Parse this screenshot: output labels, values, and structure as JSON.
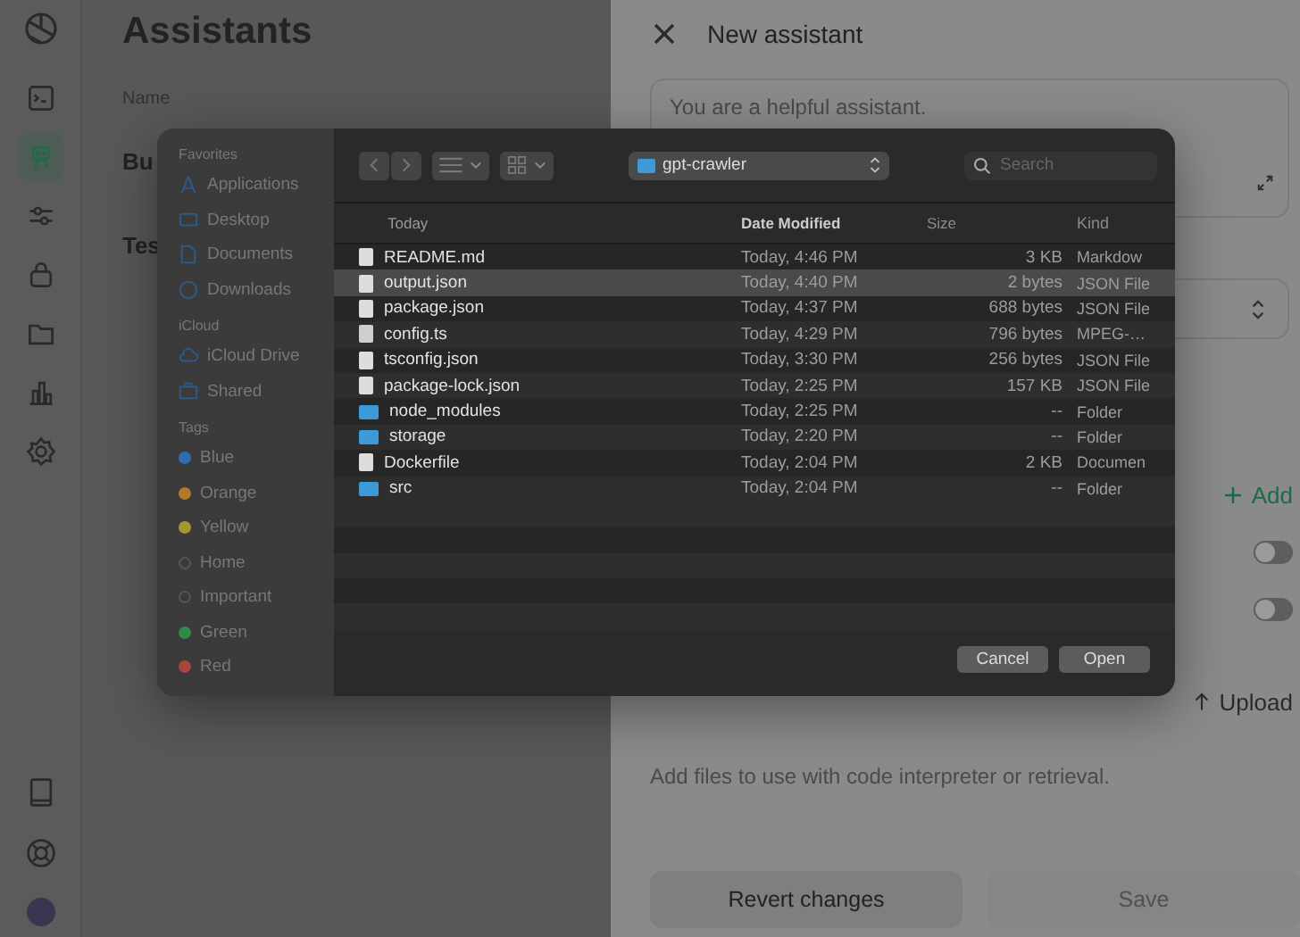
{
  "nav": {
    "top": [
      {
        "selected": false
      },
      {
        "selected": true
      },
      {
        "selected": false
      },
      {
        "selected": false
      },
      {
        "selected": false
      },
      {
        "selected": false
      },
      {
        "selected": false
      }
    ]
  },
  "list": {
    "title": "Assistants",
    "header": "Name",
    "items": [
      "Bu",
      "Tes"
    ]
  },
  "panel": {
    "title": "New assistant",
    "instructions_placeholder": "You are a helpful assistant.",
    "tools": [
      {
        "kind": "add",
        "label": "Add"
      },
      {
        "kind": "toggle",
        "on": false
      },
      {
        "kind": "toggle",
        "on": false
      },
      {
        "kind": "upload",
        "label": "Upload"
      }
    ],
    "files_hint": "Add files to use with code interpreter or retrieval.",
    "buttons": [
      {
        "label": "Revert changes",
        "disabled": false
      },
      {
        "label": "Save",
        "disabled": true
      }
    ]
  },
  "dialog": {
    "sidebar": [
      {
        "heading": "Favorites",
        "items": [
          {
            "label": "Applications"
          },
          {
            "label": "Desktop"
          },
          {
            "label": "Documents"
          },
          {
            "label": "Downloads"
          }
        ]
      },
      {
        "heading": "iCloud",
        "items": [
          {
            "label": "iCloud Drive"
          },
          {
            "label": "Shared"
          }
        ]
      },
      {
        "heading": "Tags",
        "items": [
          {
            "label": "Blue",
            "color": "#2f6db0"
          },
          {
            "label": "Orange",
            "color": "#b07a2a"
          },
          {
            "label": "Yellow",
            "color": "#a8962a"
          },
          {
            "label": "Home"
          },
          {
            "label": "Important"
          },
          {
            "label": "Green",
            "color": "#2f8a45"
          },
          {
            "label": "Red",
            "color": "#a8463c"
          }
        ]
      }
    ],
    "location": "gpt-crawler",
    "search_placeholder": "Search",
    "columns": [
      "Today",
      "Date Modified",
      "Size",
      "Kind"
    ],
    "files": [
      {
        "name": "README.md",
        "kind": "doc",
        "date": "Today, 4:46 PM",
        "size": "3 KB",
        "type": "Markdow",
        "selected": false
      },
      {
        "name": "output.json",
        "kind": "doc",
        "date": "Today, 4:40 PM",
        "size": "2 bytes",
        "type": "JSON File",
        "selected": true
      },
      {
        "name": "package.json",
        "kind": "doc",
        "date": "Today, 4:37 PM",
        "size": "688 bytes",
        "type": "JSON File",
        "selected": false
      },
      {
        "name": "config.ts",
        "kind": "ts",
        "date": "Today, 4:29 PM",
        "size": "796 bytes",
        "type": "MPEG-…",
        "selected": false
      },
      {
        "name": "tsconfig.json",
        "kind": "doc",
        "date": "Today, 3:30 PM",
        "size": "256 bytes",
        "type": "JSON File",
        "selected": false
      },
      {
        "name": "package-lock.json",
        "kind": "doc",
        "date": "Today, 2:25 PM",
        "size": "157 KB",
        "type": "JSON File",
        "selected": false
      },
      {
        "name": "node_modules",
        "kind": "folder",
        "date": "Today, 2:25 PM",
        "size": "--",
        "type": "Folder",
        "selected": false
      },
      {
        "name": "storage",
        "kind": "folder",
        "date": "Today, 2:20 PM",
        "size": "--",
        "type": "Folder",
        "selected": false
      },
      {
        "name": "Dockerfile",
        "kind": "doc",
        "date": "Today, 2:04 PM",
        "size": "2 KB",
        "type": "Documen",
        "selected": false
      },
      {
        "name": "src",
        "kind": "folder",
        "date": "Today, 2:04 PM",
        "size": "--",
        "type": "Folder",
        "selected": false
      }
    ],
    "buttons": [
      "Cancel",
      "Open"
    ]
  }
}
